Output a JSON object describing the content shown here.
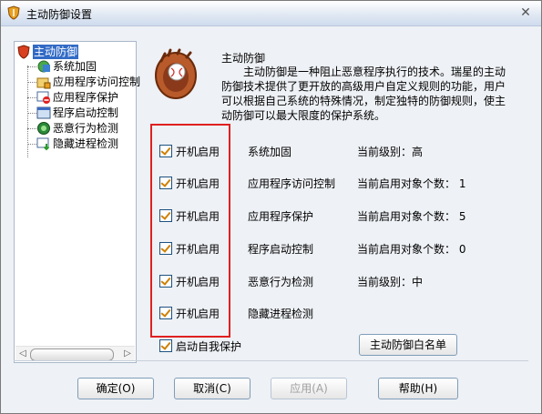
{
  "window": {
    "title": "主动防御设置"
  },
  "tree": {
    "root": "主动防御",
    "items": [
      "系统加固",
      "应用程序访问控制",
      "应用程序保护",
      "程序启动控制",
      "恶意行为检测",
      "隐藏进程检测"
    ]
  },
  "intro": {
    "title": "主动防御",
    "body": "主动防御是一种阻止恶意程序执行的技术。瑞星的主动防御技术提供了更开放的高级用户自定义规则的功能，用户可以根据自己系统的特殊情况，制定独特的防御规则，使主动防御可以最大限度的保护系统。"
  },
  "rows": [
    {
      "checkbox": "开机启用",
      "checked": true,
      "feature": "系统加固",
      "status": "当前级别：高"
    },
    {
      "checkbox": "开机启用",
      "checked": true,
      "feature": "应用程序访问控制",
      "status": "当前启用对象个数： 1"
    },
    {
      "checkbox": "开机启用",
      "checked": true,
      "feature": "应用程序保护",
      "status": "当前启用对象个数： 5"
    },
    {
      "checkbox": "开机启用",
      "checked": true,
      "feature": "程序启动控制",
      "status": "当前启用对象个数： 0"
    },
    {
      "checkbox": "开机启用",
      "checked": true,
      "feature": "恶意行为检测",
      "status": "当前级别：中"
    },
    {
      "checkbox": "开机启用",
      "checked": true,
      "feature": "隐藏进程检测",
      "status": ""
    }
  ],
  "self_protect": {
    "label": "启动自我保护",
    "checked": true
  },
  "whitelist_button": "主动防御白名单",
  "buttons": {
    "ok": "确定(O)",
    "cancel": "取消(C)",
    "apply": "应用(A)",
    "help": "帮助(H)"
  },
  "icons": {
    "app": "shield-icon",
    "close": "close-icon",
    "glove": "baseball-glove-icon"
  }
}
